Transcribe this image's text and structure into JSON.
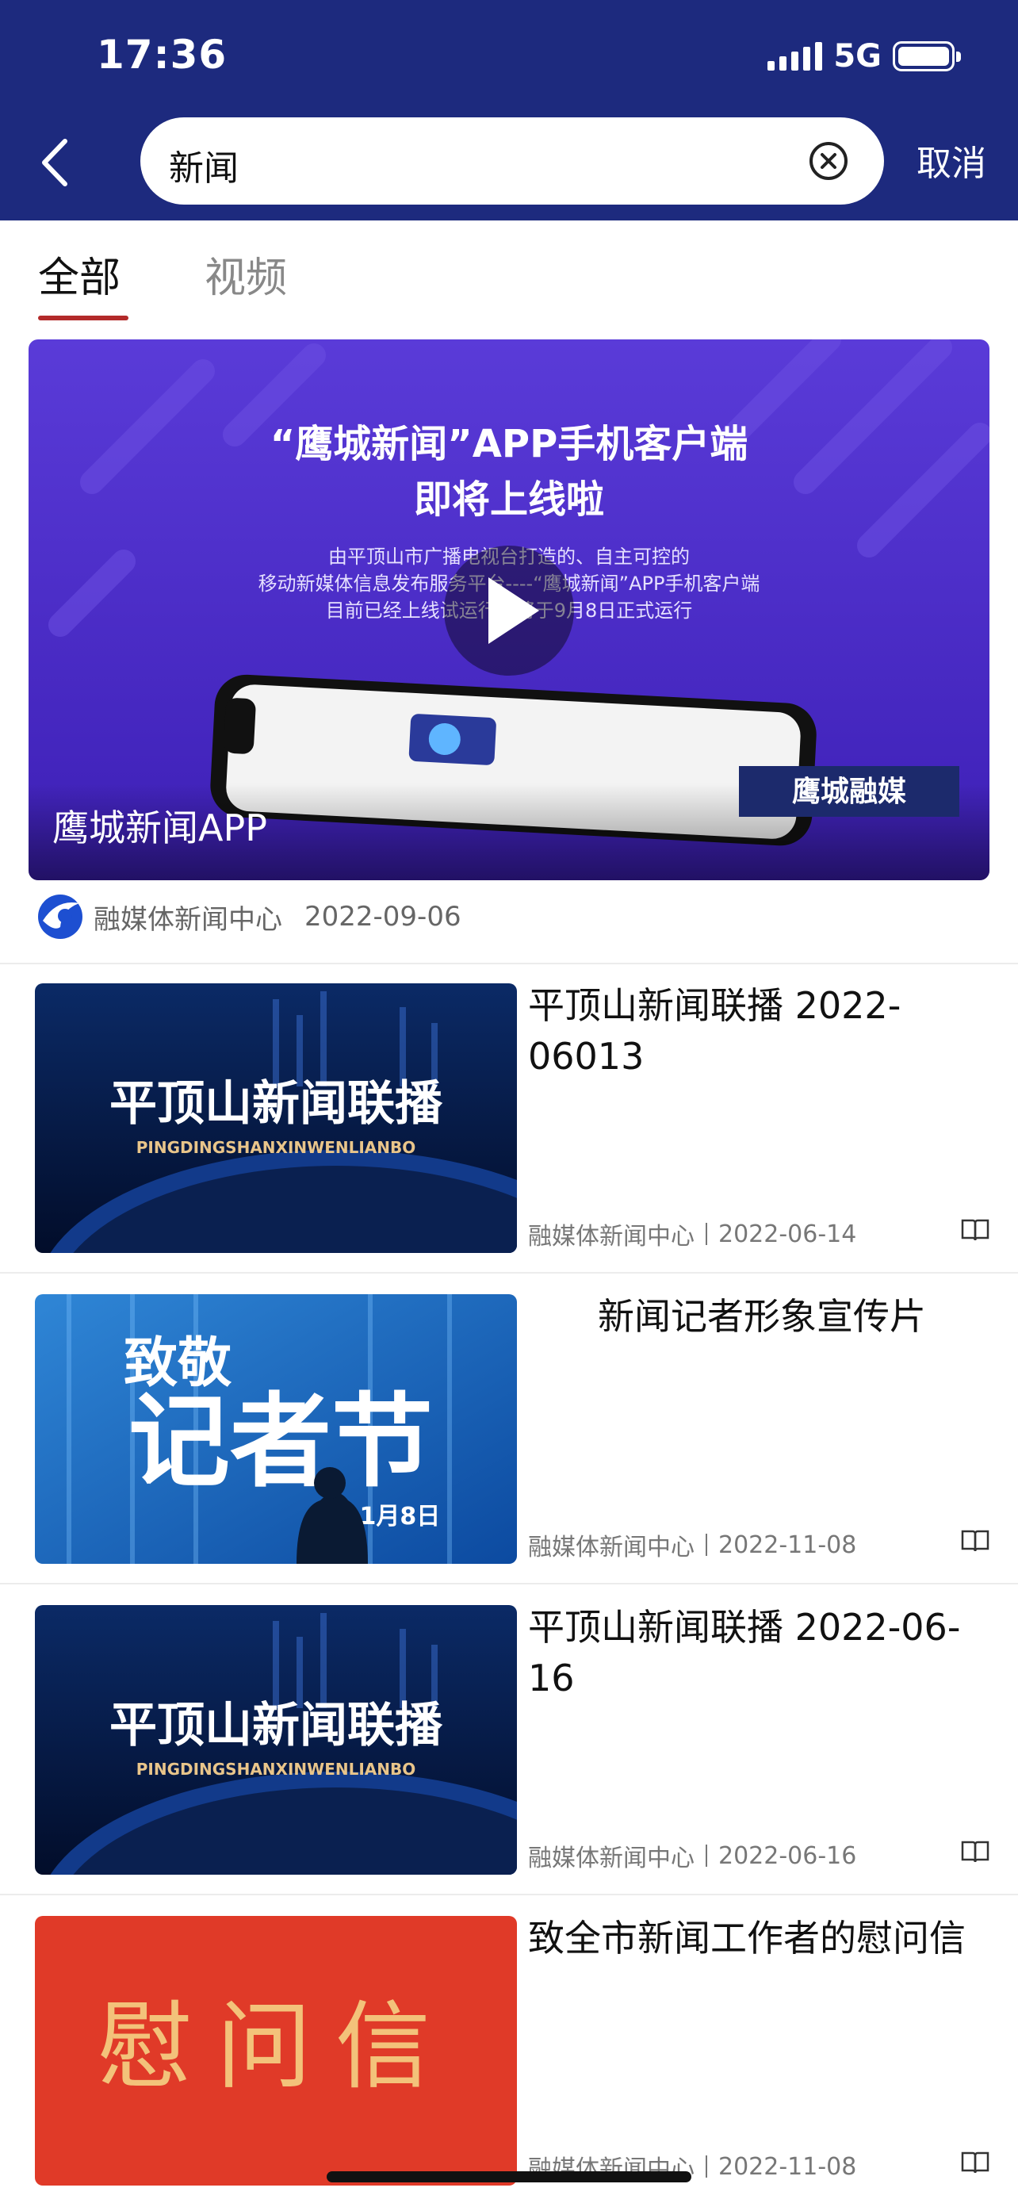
{
  "status_bar": {
    "time": "17:36",
    "network": "5G"
  },
  "search": {
    "query": "新闻",
    "cancel_label": "取消"
  },
  "tabs": [
    {
      "label": "全部",
      "active": true
    },
    {
      "label": "视频",
      "active": false
    }
  ],
  "feature": {
    "poster_headline_1": "“鹰城新闻”APP手机客户端",
    "poster_headline_2": "即将上线啦",
    "poster_body_1": "由平顶山市广播电视台打造的、自主可控的",
    "poster_body_2": "移动新媒体信息发布服务平台----“鹰城新闻”APP手机客户端",
    "poster_body_3": "目前已经上线试运行，将于9月8日正式运行",
    "poster_badge": "鹰城融媒",
    "caption": "鹰城新闻APP",
    "source": "融媒体新闻中心",
    "date": "2022-09-06"
  },
  "items": [
    {
      "title": "平顶山新闻联播 2022-06013",
      "thumb_text": "平顶山新闻联播",
      "thumb_sub": "PINGDINGSHANXINWENLIANBO",
      "source": "融媒体新闻中心",
      "date": "2022-06-14"
    },
    {
      "title": "新闻记者形象宣传片",
      "thumb_text_1": "致敬",
      "thumb_text_2": "记者节",
      "thumb_text_3": "11月8日",
      "source": "融媒体新闻中心",
      "date": "2022-11-08"
    },
    {
      "title": "平顶山新闻联播 2022-06-16",
      "thumb_text": "平顶山新闻联播",
      "thumb_sub": "PINGDINGSHANXINWENLIANBO",
      "source": "融媒体新闻中心",
      "date": "2022-06-16"
    },
    {
      "title": "致全市新闻工作者的慰问信",
      "thumb_text": "慰问信",
      "source": "融媒体新闻中心",
      "date": "2022-11-08"
    }
  ],
  "colors": {
    "header_bg": "#1d2a7e",
    "tab_indicator": "#b22a2a",
    "feature_bg": "#4b2fd0"
  }
}
